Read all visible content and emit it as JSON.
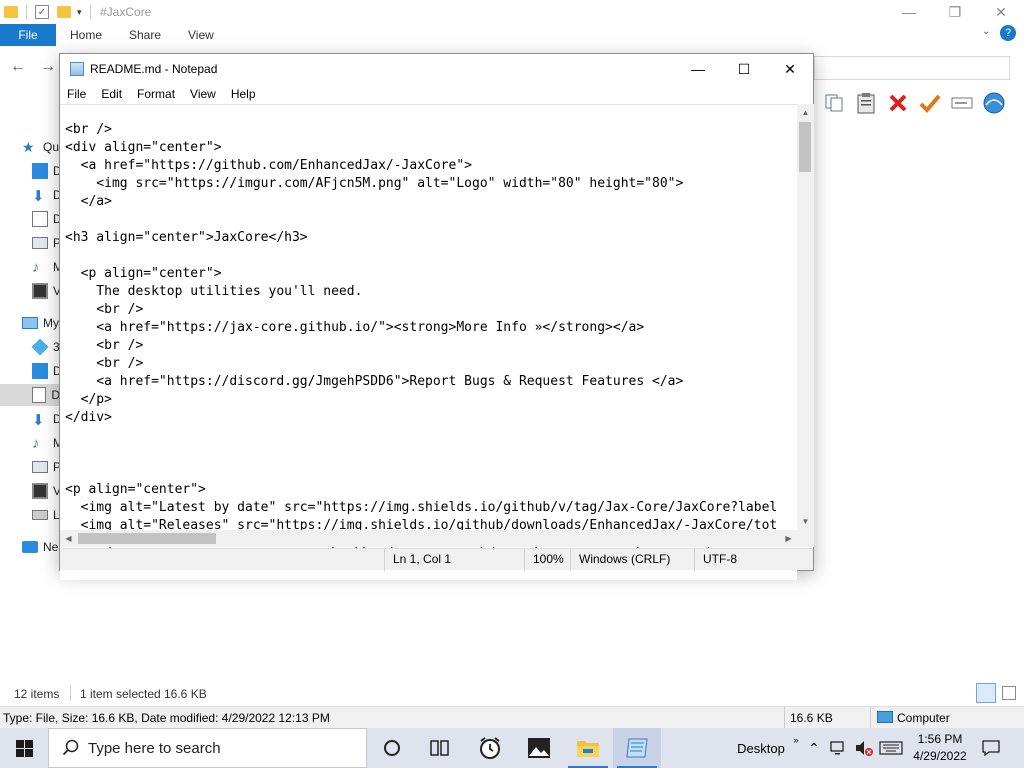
{
  "explorer": {
    "title": "#JaxCore",
    "ribbon_tabs": [
      "File",
      "Home",
      "Share",
      "View"
    ],
    "nav_items": [
      {
        "label": "Qu",
        "icon": "quick-access-star-icon"
      },
      {
        "label": "D",
        "icon": "desktop-folder-icon"
      },
      {
        "label": "D",
        "icon": "downloads-arrow-icon"
      },
      {
        "label": "D",
        "icon": "documents-icon"
      },
      {
        "label": "P",
        "icon": "pictures-icon"
      },
      {
        "label": "M",
        "icon": "music-note-icon"
      },
      {
        "label": "V",
        "icon": "videos-icon"
      },
      {
        "label": "My",
        "icon": "this-pc-icon"
      },
      {
        "label": "3",
        "icon": "3d-objects-icon"
      },
      {
        "label": "D",
        "icon": "desktop-folder-icon"
      },
      {
        "label": "D",
        "icon": "documents-icon"
      },
      {
        "label": "D",
        "icon": "downloads-arrow-icon"
      },
      {
        "label": "M",
        "icon": "music-note-icon"
      },
      {
        "label": "P",
        "icon": "pictures-icon"
      },
      {
        "label": "V",
        "icon": "videos-icon"
      },
      {
        "label": "L",
        "icon": "local-disk-icon"
      },
      {
        "label": "Ne",
        "icon": "network-icon"
      }
    ],
    "status": {
      "items_count": "12 items",
      "selected": "1 item selected",
      "selected_size": "16.6 KB"
    },
    "info_bar": {
      "details": "Type: File, Size: 16.6 KB, Date modified: 4/29/2022 12:13 PM",
      "size": "16.6 KB",
      "location": "Computer"
    }
  },
  "notepad": {
    "title": "README.md - Notepad",
    "menu": [
      "File",
      "Edit",
      "Format",
      "View",
      "Help"
    ],
    "content_lines": [
      "<br />",
      "<div align=\"center\">",
      "  <a href=\"https://github.com/EnhancedJax/-JaxCore\">",
      "    <img src=\"https://imgur.com/AFjcn5M.png\" alt=\"Logo\" width=\"80\" height=\"80\">",
      "  </a>",
      "",
      "<h3 align=\"center\">JaxCore</h3>",
      "",
      "  <p align=\"center\">",
      "    The desktop utilities you'll need.",
      "    <br />",
      "    <a href=\"https://jax-core.github.io/\"><strong>More Info »</strong></a>",
      "    <br />",
      "    <br />",
      "    <a href=\"https://discord.gg/JmgehPSDD6\">Report Bugs & Request Features </a>",
      "  </p>",
      "</div>",
      "",
      "",
      "",
      "<p align=\"center\">",
      "  <img alt=\"Latest by date\" src=\"https://img.shields.io/github/v/tag/Jax-Core/JaxCore?label",
      "  <img alt=\"Releases\" src=\"https://img.shields.io/github/downloads/EnhancedJax/-JaxCore/tot",
      "  <img alt=\"Release date\" src=\"https://img.shields.io/github/release-date/Jax-Core/JaxCore?"
    ],
    "status": {
      "position": "Ln 1, Col 1",
      "zoom": "100%",
      "line_endings": "Windows (CRLF)",
      "encoding": "UTF-8"
    }
  },
  "taskbar": {
    "search_placeholder": "Type here to search",
    "desktop_label": "Desktop",
    "time": "1:56 PM",
    "date": "4/29/2022"
  },
  "colors": {
    "ribbon_file_tab": "#1979ca",
    "taskbar_bg": "#dfe3ee",
    "selection_bg": "#d9d9d9",
    "close_x_red": "#e02020",
    "check_orange": "#e07818"
  }
}
